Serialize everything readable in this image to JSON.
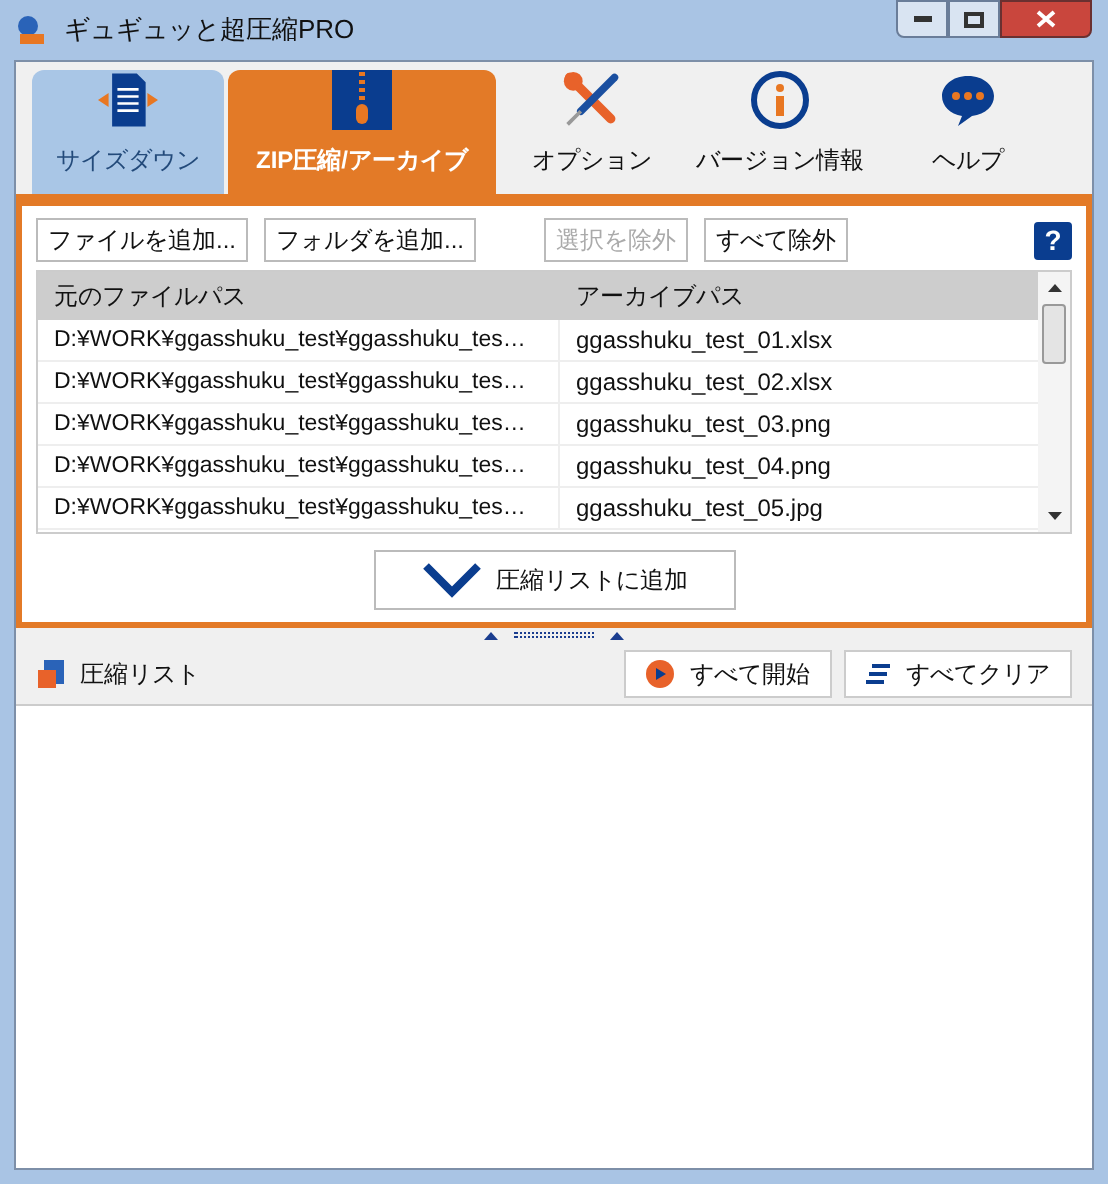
{
  "window": {
    "title": "ギュギュッと超圧縮PRO"
  },
  "tabs": [
    {
      "label": "サイズダウン",
      "kind": "resize",
      "selected": false,
      "highlighted": true
    },
    {
      "label": "ZIP圧縮/アーカイブ",
      "kind": "zip",
      "selected": true,
      "highlighted": false
    },
    {
      "label": "オプション",
      "kind": "tools",
      "selected": false,
      "highlighted": false
    },
    {
      "label": "バージョン情報",
      "kind": "info",
      "selected": false,
      "highlighted": false
    },
    {
      "label": "ヘルプ",
      "kind": "help",
      "selected": false,
      "highlighted": false
    }
  ],
  "toolbar": [
    {
      "label": "ファイルを追加...",
      "disabled": false
    },
    {
      "label": "フォルダを追加...",
      "disabled": false
    },
    {
      "label": "選択を除外",
      "disabled": true
    },
    {
      "label": "すべて除外",
      "disabled": false
    }
  ],
  "help_button": "?",
  "table": {
    "columns": [
      "元のファイルパス",
      "アーカイブパス"
    ],
    "rows": [
      [
        "D:¥WORK¥ggasshuku_test¥ggasshuku_tes…",
        "ggasshuku_test_01.xlsx"
      ],
      [
        "D:¥WORK¥ggasshuku_test¥ggasshuku_tes…",
        "ggasshuku_test_02.xlsx"
      ],
      [
        "D:¥WORK¥ggasshuku_test¥ggasshuku_tes…",
        "ggasshuku_test_03.png"
      ],
      [
        "D:¥WORK¥ggasshuku_test¥ggasshuku_tes…",
        "ggasshuku_test_04.png"
      ],
      [
        "D:¥WORK¥ggasshuku_test¥ggasshuku_tes…",
        "ggasshuku_test_05.jpg"
      ]
    ]
  },
  "add_button": "圧縮リストに追加",
  "list": {
    "title": "圧縮リスト",
    "buttons": [
      {
        "label": "すべて開始",
        "kind": "start"
      },
      {
        "label": "すべてクリア",
        "kind": "clear"
      }
    ]
  }
}
